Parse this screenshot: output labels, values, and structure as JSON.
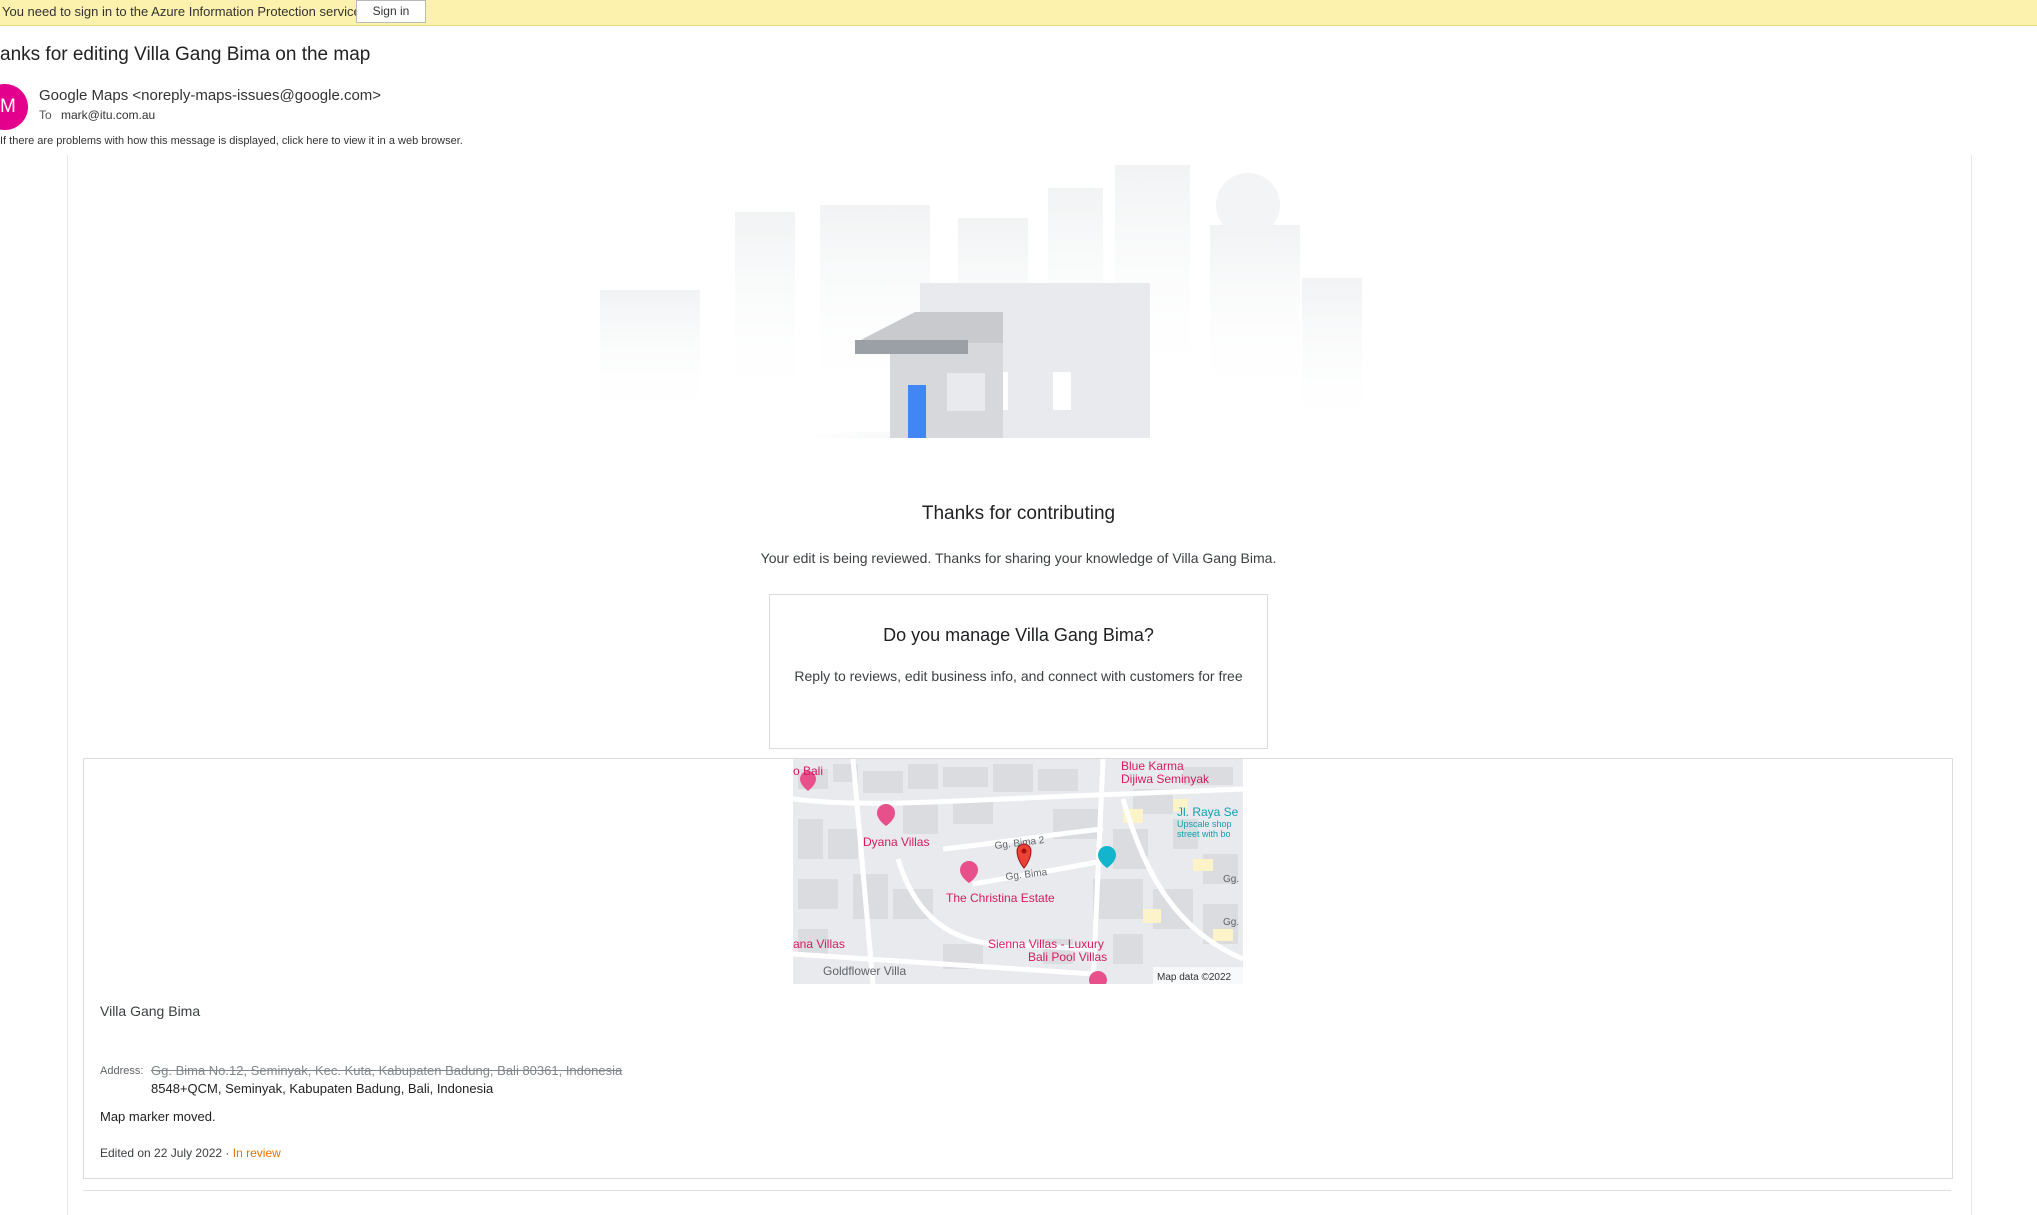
{
  "infobar": {
    "message": "You need to sign in to the Azure Information Protection service",
    "signin_label": "Sign in"
  },
  "email": {
    "subject": "anks for editing Villa Gang Bima on the map",
    "avatar_initials": "M",
    "sender": "Google Maps <noreply-maps-issues@google.com>",
    "to_label": "To",
    "to_value": "mark@itu.com.au",
    "notice": "If there are problems with how this message is displayed, click here to view it in a web browser."
  },
  "body": {
    "thanks_title": "Thanks for contributing",
    "thanks_subtitle": "Your edit is being reviewed. Thanks for sharing your knowledge of Villa Gang Bima.",
    "manage_title": "Do you manage Villa Gang Bima?",
    "manage_subtitle": "Reply to reviews, edit business info, and connect with customers for free"
  },
  "map": {
    "labels": {
      "bali": "o Bali",
      "blue_karma_1": "Blue Karma",
      "blue_karma_2": "Dijiwa Seminyak",
      "dyana": "Dyana Villas",
      "gg_bima_2": "Gg. Bima 2",
      "gg_bima": "Gg. Bima",
      "christina": "The Christina Estate",
      "jl_raya_1": "Jl. Raya Se",
      "jl_raya_2": "Upscale shop",
      "jl_raya_3": "street with bo",
      "gg_a": "Gg.",
      "gg_b": "Gg.",
      "ana_villas": "ana Villas",
      "sienna_1": "Sienna Villas - Luxury",
      "sienna_2": "Bali Pool Villas",
      "goldflower": "Goldflower Villa",
      "copyright": "Map data ©2022"
    },
    "colors": {
      "poi": "#d81b60",
      "pin": "#ea4335",
      "shopping": "#12b5cb"
    }
  },
  "edit": {
    "place_name": "Villa Gang Bima",
    "address_label": "Address:",
    "address_old": "Gg. Bima No.12, Seminyak, Kec. Kuta, Kabupaten Badung, Bali 80361, Indonesia",
    "address_new": "8548+QCM, Seminyak, Kabupaten Badung, Bali, Indonesia",
    "marker_note": "Map marker moved.",
    "edited_text": "Edited on 22 July 2022",
    "separator": " · ",
    "status": "In review"
  }
}
